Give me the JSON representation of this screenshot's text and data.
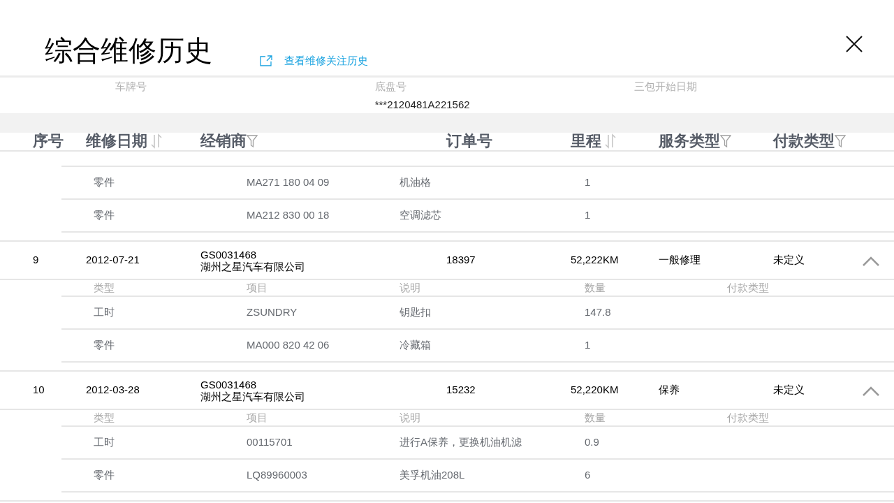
{
  "title": "综合维修历史",
  "link": "查看维修关注历史",
  "vehicle_info": [
    {
      "label": "车牌号"
    },
    {
      "label": "底盘号",
      "value": "***2120481A221562"
    },
    {
      "label": "三包开始日期"
    }
  ],
  "columns": [
    {
      "label": "序号"
    },
    {
      "label": "维修日期",
      "kind": "sort"
    },
    {
      "label": "经销商",
      "kind": "filter"
    },
    {
      "label": "订单号"
    },
    {
      "label": "里程",
      "kind": "sort"
    },
    {
      "label": "服务类型",
      "kind": "filter"
    },
    {
      "label": "付款类型",
      "kind": "filter"
    }
  ],
  "continued_items": [
    {
      "type": "零件",
      "item": "MA271 180 04 09",
      "description": "机油格",
      "quantity": "1"
    },
    {
      "type": "零件",
      "item": "MA212 830 00 18",
      "description": "空调滤芯",
      "quantity": "1"
    }
  ],
  "records": [
    {
      "index": "9",
      "date": "2012-07-21",
      "dealer_code": "GS0031468",
      "dealer_name": "湖州之星汽车有限公司",
      "order": "18397",
      "mileage": "52,222KM",
      "service_type": "一般修理",
      "payment_type": "未定义",
      "expanded": true,
      "item_columns": [
        "类型",
        "项目",
        "说明",
        "数量",
        "付款类型"
      ],
      "items": [
        {
          "type": "工时",
          "item": "ZSUNDRY",
          "description": "钥匙扣",
          "quantity": "147.8"
        },
        {
          "type": "零件",
          "item": "MA000 820 42 06",
          "description": "冷藏箱",
          "quantity": "1"
        }
      ]
    },
    {
      "index": "10",
      "date": "2012-03-28",
      "dealer_code": "GS0031468",
      "dealer_name": "湖州之星汽车有限公司",
      "order": "15232",
      "mileage": "52,220KM",
      "service_type": "保养",
      "payment_type": "未定义",
      "expanded": true,
      "item_columns": [
        "类型",
        "项目",
        "说明",
        "数量",
        "付款类型"
      ],
      "items": [
        {
          "type": "工时",
          "item": "00115701",
          "description": "进行A保养，更换机油机滤",
          "quantity": "0.9"
        },
        {
          "type": "零件",
          "item": "LQ89960003",
          "description": "美孚机油208L",
          "quantity": "6"
        }
      ]
    }
  ]
}
